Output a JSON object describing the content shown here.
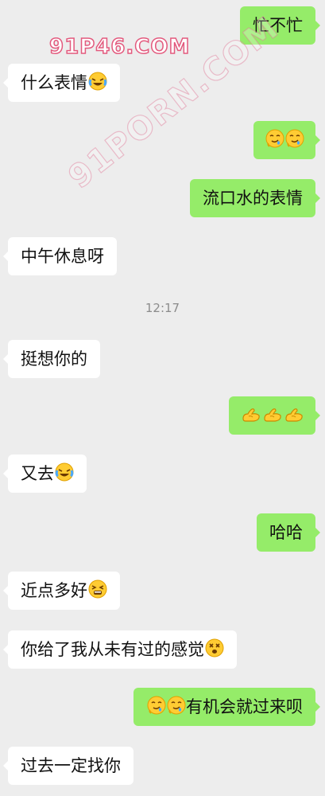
{
  "watermarks": {
    "top": "91P46.COM",
    "diagonal": "91PORN.COM"
  },
  "timestamp": "12:17",
  "messages": [
    {
      "side": "out",
      "text": "忙不忙",
      "emoji_before": [],
      "emoji_after": []
    },
    {
      "side": "in",
      "text": "什么表情",
      "emoji_before": [],
      "emoji_after": [
        "crying-laughing-icon"
      ]
    },
    {
      "side": "out",
      "text": "",
      "emoji_before": [
        "drooling-icon",
        "drooling-icon"
      ],
      "emoji_after": []
    },
    {
      "side": "out",
      "text": "流口水的表情",
      "emoji_before": [],
      "emoji_after": []
    },
    {
      "side": "in",
      "text": "中午休息呀",
      "emoji_before": [],
      "emoji_after": []
    },
    {
      "side": "in",
      "text": "挺想你的",
      "emoji_before": [],
      "emoji_after": []
    },
    {
      "side": "out",
      "text": "",
      "emoji_before": [
        "flexed-arm-icon",
        "flexed-arm-icon",
        "flexed-arm-icon"
      ],
      "emoji_after": []
    },
    {
      "side": "in",
      "text": "又去",
      "emoji_before": [],
      "emoji_after": [
        "crying-laughing-icon"
      ]
    },
    {
      "side": "out",
      "text": "哈哈",
      "emoji_before": [],
      "emoji_after": []
    },
    {
      "side": "in",
      "text": "近点多好",
      "emoji_before": [],
      "emoji_after": [
        "tired-face-icon"
      ]
    },
    {
      "side": "in",
      "text": "你给了我从未有过的感觉",
      "emoji_before": [],
      "emoji_after": [
        "dizzy-face-icon"
      ]
    },
    {
      "side": "out",
      "text": "有机会就过来呗",
      "emoji_before": [
        "drooling-icon",
        "drooling-icon"
      ],
      "emoji_after": []
    },
    {
      "side": "in",
      "text": "过去一定找你",
      "emoji_before": [],
      "emoji_after": []
    }
  ]
}
